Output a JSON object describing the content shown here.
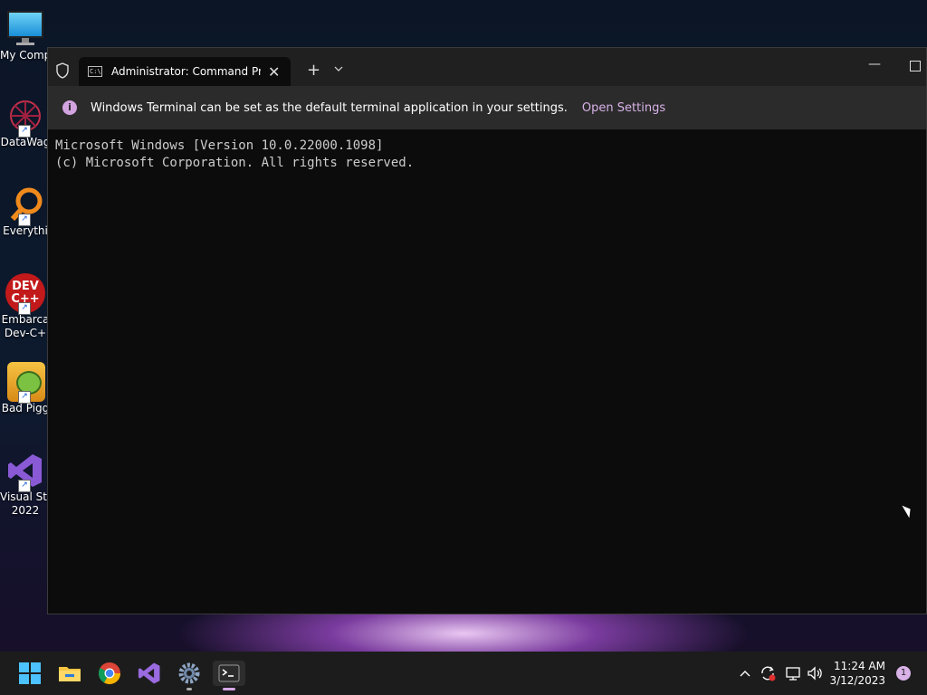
{
  "desktop": {
    "icons": [
      {
        "label": "My Comp",
        "label2": "",
        "icon": "monitor-icon"
      },
      {
        "label": "DataWag",
        "label2": "",
        "icon": "datawag-icon"
      },
      {
        "label": "Everythi",
        "label2": "",
        "icon": "everything-search-icon"
      },
      {
        "label": "Embarca",
        "label2": "Dev-C+",
        "icon": "devcpp-icon"
      },
      {
        "label": "Bad Pigg",
        "label2": "",
        "icon": "bad-piggies-icon"
      },
      {
        "label": "Visual Stu",
        "label2": "2022",
        "icon": "visual-studio-icon"
      }
    ]
  },
  "terminal": {
    "tab_title": "Administrator:  Command Prc",
    "new_tab_symbol": "+",
    "dropdown_symbol": "⌵",
    "infobar": {
      "message": "Windows Terminal can be set as the default terminal application in your settings.",
      "link": "Open Settings"
    },
    "console_lines": [
      "Microsoft Windows [Version 10.0.22000.1098]",
      "(c) Microsoft Corporation. All rights reserved."
    ]
  },
  "taskbar": {
    "apps": [
      "start-icon",
      "file-explorer-icon",
      "chrome-icon",
      "visual-studio-icon",
      "settings-icon",
      "terminal-icon"
    ],
    "clock_time": "11:24 AM",
    "clock_date": "3/12/2023",
    "notification_count": "1"
  },
  "colors": {
    "accent": "#d9b2e8",
    "terminal_bg": "#0c0c0c",
    "taskbar_bg": "#1c1c1c"
  }
}
